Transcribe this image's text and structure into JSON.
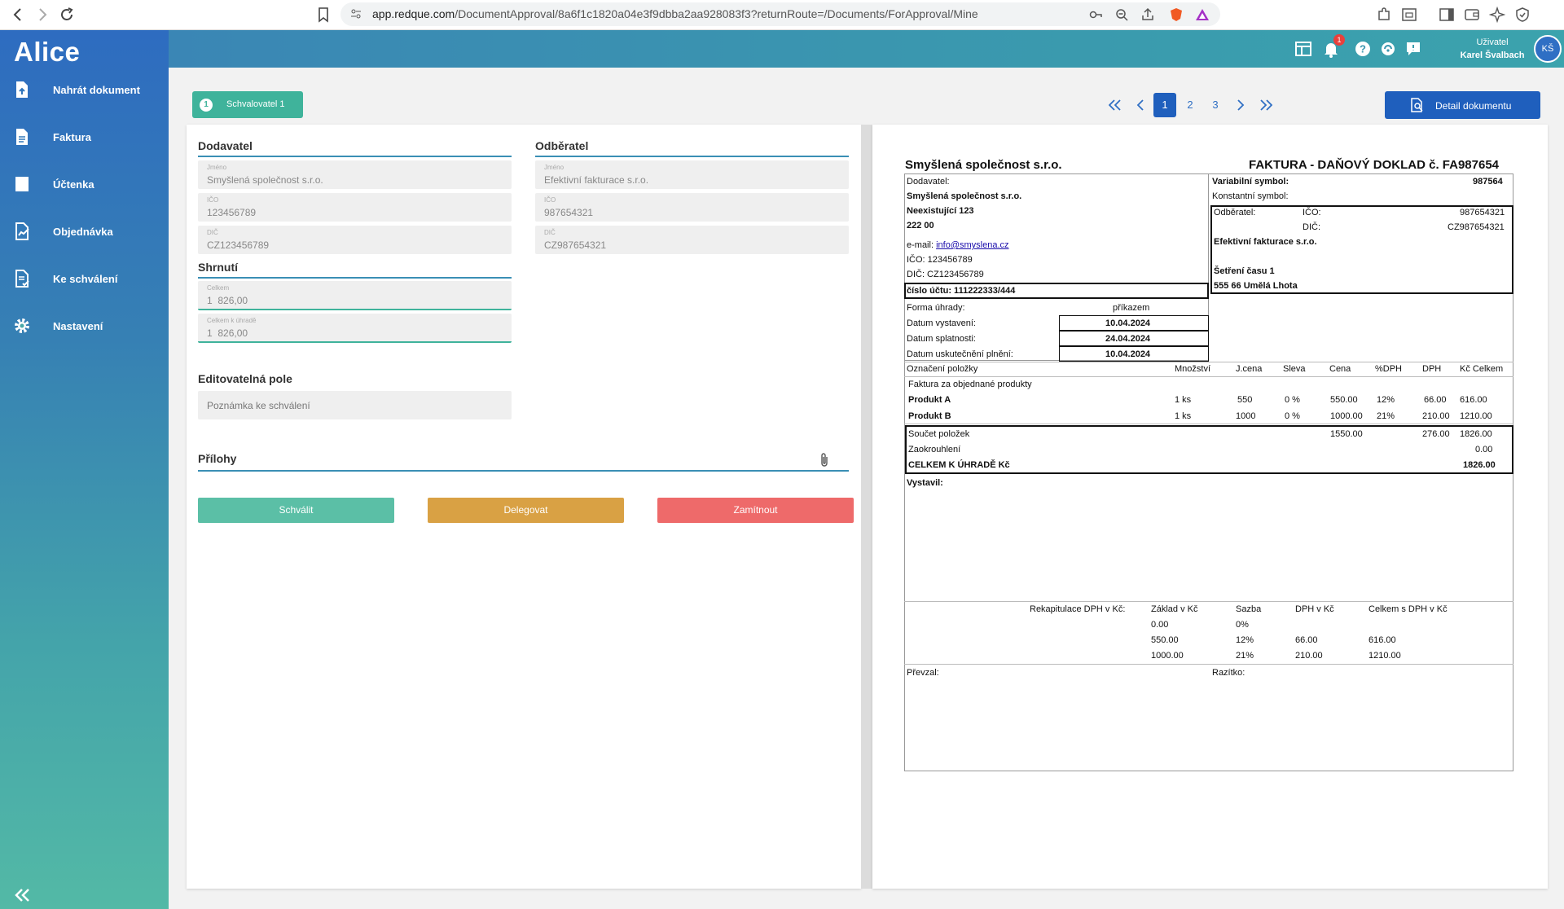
{
  "browser": {
    "url_host": "app.redque.com",
    "url_path": "/DocumentApproval/8a6f1c1820a04e3f9dbba2aa928083f3?returnRoute=/Documents/ForApproval/Mine"
  },
  "app": {
    "logo": "Alice"
  },
  "sidebar": {
    "items": [
      {
        "label": "Nahrát dokument",
        "icon": "upload-file-icon"
      },
      {
        "label": "Faktura",
        "icon": "document-icon"
      },
      {
        "label": "Účtenka",
        "icon": "receipt-icon"
      },
      {
        "label": "Objednávka",
        "icon": "order-icon"
      },
      {
        "label": "Ke schválení",
        "icon": "approval-icon"
      },
      {
        "label": "Nastavení",
        "icon": "gear-icon"
      }
    ]
  },
  "header": {
    "notification_count": "1",
    "user_role": "Uživatel",
    "user_name": "Karel Švalbach",
    "user_initials": "KŠ"
  },
  "workflow": {
    "step_number": "1",
    "step_label": "Schvalovatel 1"
  },
  "pager": {
    "pages": [
      "1",
      "2",
      "3"
    ],
    "current": "1"
  },
  "detail_button": "Detail dokumentu",
  "form": {
    "supplier": {
      "title": "Dodavatel",
      "name_label": "Jméno",
      "name": "Smyšlená společnost s.r.o.",
      "ico_label": "IČO",
      "ico": "123456789",
      "dic_label": "DIČ",
      "dic": "CZ123456789"
    },
    "customer": {
      "title": "Odběratel",
      "name_label": "Jméno",
      "name": "Efektivní fakturace s.r.o.",
      "ico_label": "IČO",
      "ico": "987654321",
      "dic_label": "DIČ",
      "dic": "CZ987654321"
    },
    "summary": {
      "title": "Shrnutí",
      "total_label": "Celkem",
      "total": "1  826,00",
      "to_pay_label": "Celkem k úhradě",
      "to_pay": "1  826,00"
    },
    "editable": {
      "title": "Editovatelná pole",
      "note_placeholder": "Poznámka ke schválení"
    },
    "attachments": {
      "title": "Přílohy"
    },
    "actions": {
      "approve": "Schválit",
      "delegate": "Delegovat",
      "reject": "Zamítnout"
    }
  },
  "colors": {
    "approve": "#5bbfa6",
    "delegate": "#d9a144",
    "reject": "#ee6a6a",
    "primary": "#1f5fbd"
  },
  "invoice": {
    "company": "Smyšlená společnost s.r.o.",
    "doc_title": "FAKTURA - DAŇOVÝ DOKLAD č. FA987654",
    "supplier_label": "Dodavatel:",
    "supplier_name": "Smyšlená společnost s.r.o.",
    "supplier_street": "Neexistující 123",
    "supplier_zip": "222 00",
    "email_label": "e-mail:",
    "email": "info@smyslena.cz",
    "ico_line": "IČO: 123456789",
    "dic_line": "DIČ: CZ123456789",
    "account": "číslo účtu: 111222333/444",
    "var_symbol_label": "Variabilní symbol:",
    "var_symbol": "987564",
    "const_symbol_label": "Konstantní symbol:",
    "customer_label": "Odběratel:",
    "cust_ico_label": "IČO:",
    "cust_ico": "987654321",
    "cust_dic_label": "DIČ:",
    "cust_dic": "CZ987654321",
    "customer_name": "Efektivní fakturace s.r.o.",
    "customer_street": "Šetření času 1",
    "customer_city": "555 66 Umělá Lhota",
    "payment_label": "Forma úhrady:",
    "payment": "příkazem",
    "issue_label": "Datum vystavení:",
    "issue_date": "10.04.2024",
    "due_label": "Datum splatnosti:",
    "due_date": "24.04.2024",
    "tax_label": "Datum uskutečnění plnění:",
    "tax_date": "10.04.2024",
    "items_headers": [
      "Označení položky",
      "Množství",
      "J.cena",
      "Sleva",
      "Cena",
      "%DPH",
      "DPH",
      "Kč Celkem"
    ],
    "items_intro": "Faktura za objednané produkty",
    "items": [
      {
        "name": "Produkt A",
        "qty": "1 ks",
        "unit": "550",
        "disc": "0 %",
        "price": "550.00",
        "vat_pct": "12%",
        "vat": "66.00",
        "total": "616.00"
      },
      {
        "name": "Produkt B",
        "qty": "1 ks",
        "unit": "1000",
        "disc": "0 %",
        "price": "1000.00",
        "vat_pct": "21%",
        "vat": "210.00",
        "total": "1210.00"
      }
    ],
    "sum_label": "Součet položek",
    "sum_price": "1550.00",
    "sum_vat": "276.00",
    "sum_total": "1826.00",
    "rounding_label": "Zaokrouhlení",
    "rounding": "0.00",
    "grand_label": "CELKEM K ÚHRADĚ Kč",
    "grand_total": "1826.00",
    "issued_by": "Vystavil:",
    "recap_label": "Rekapitulace DPH v Kč:",
    "recap_headers": [
      "Základ v Kč",
      "Sazba",
      "DPH v Kč",
      "Celkem s DPH v Kč"
    ],
    "recap_rows": [
      {
        "base": "0.00",
        "rate": "0%",
        "vat": "",
        "total": ""
      },
      {
        "base": "550.00",
        "rate": "12%",
        "vat": "66.00",
        "total": "616.00"
      },
      {
        "base": "1000.00",
        "rate": "21%",
        "vat": "210.00",
        "total": "1210.00"
      }
    ],
    "received_label": "Převzal:",
    "stamp_label": "Razítko:"
  }
}
